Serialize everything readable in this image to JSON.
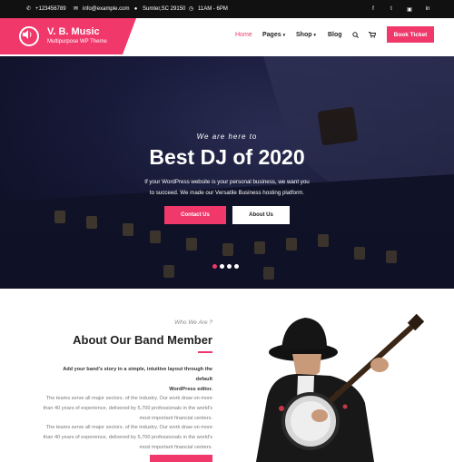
{
  "topbar": {
    "phone": "+123456789",
    "email": "info@example.com",
    "location": "Sumter,SC 29150",
    "hours": "11AM - 6PM",
    "social_icons": [
      "facebook-icon",
      "twitter-icon",
      "instagram-icon",
      "linkedin-icon"
    ]
  },
  "brand": {
    "name": "V. B. Music",
    "tagline": "Multipurpose WP Theme",
    "accent": "#f0386b"
  },
  "nav": {
    "home": "Home",
    "pages": "Pages",
    "shop": "Shop",
    "blog": "Blog",
    "book_ticket": "Book Ticket"
  },
  "hero": {
    "subtitle": "We are here to",
    "title": "Best DJ of 2020",
    "text_line1": "If your WordPress website is your personal business, we want you",
    "text_line2": "to succeed. We made our Versatile Business hosting platform.",
    "contact_label": "Contact Us",
    "about_label": "About Us",
    "slides": 4,
    "active_slide": 1
  },
  "about": {
    "eyebrow": "Who We Are ?",
    "title": "About Our Band Member",
    "intro_line1": "Add your band's story in a simple, intuitive layout through the default",
    "intro_line2": "WordPress editor.",
    "para1_line1": "The teams serve all major sectors. of the industry. Our work draw on more",
    "para1_line2": "than 40 years of experience, delivered by 5,700 professionals in the world's",
    "para1_line3": "most important financial centers.",
    "para2_line1": "The teams serve all major sectors. of the industry. Our work draw on more",
    "para2_line2": "than 40 years of experience, delivered by 5,700 professionals in the world's",
    "para2_line3": "most important financial centers."
  }
}
